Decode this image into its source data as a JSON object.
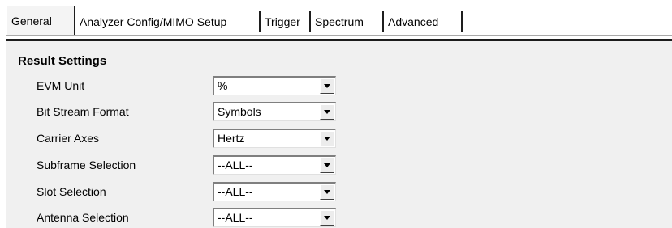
{
  "tabs": [
    {
      "label": "General",
      "active": true
    },
    {
      "label": "Analyzer Config/MIMO Setup",
      "active": false
    },
    {
      "label": "Trigger",
      "active": false
    },
    {
      "label": "Spectrum",
      "active": false
    },
    {
      "label": "Advanced",
      "active": false
    }
  ],
  "result_settings": {
    "title": "Result Settings",
    "rows": [
      {
        "label": "EVM Unit",
        "value": "%"
      },
      {
        "label": "Bit Stream Format",
        "value": "Symbols"
      },
      {
        "label": "Carrier Axes",
        "value": "Hertz"
      },
      {
        "label": "Subframe Selection",
        "value": "--ALL--"
      },
      {
        "label": "Slot Selection",
        "value": "--ALL--"
      },
      {
        "label": "Antenna Selection",
        "value": "--ALL--"
      }
    ]
  }
}
